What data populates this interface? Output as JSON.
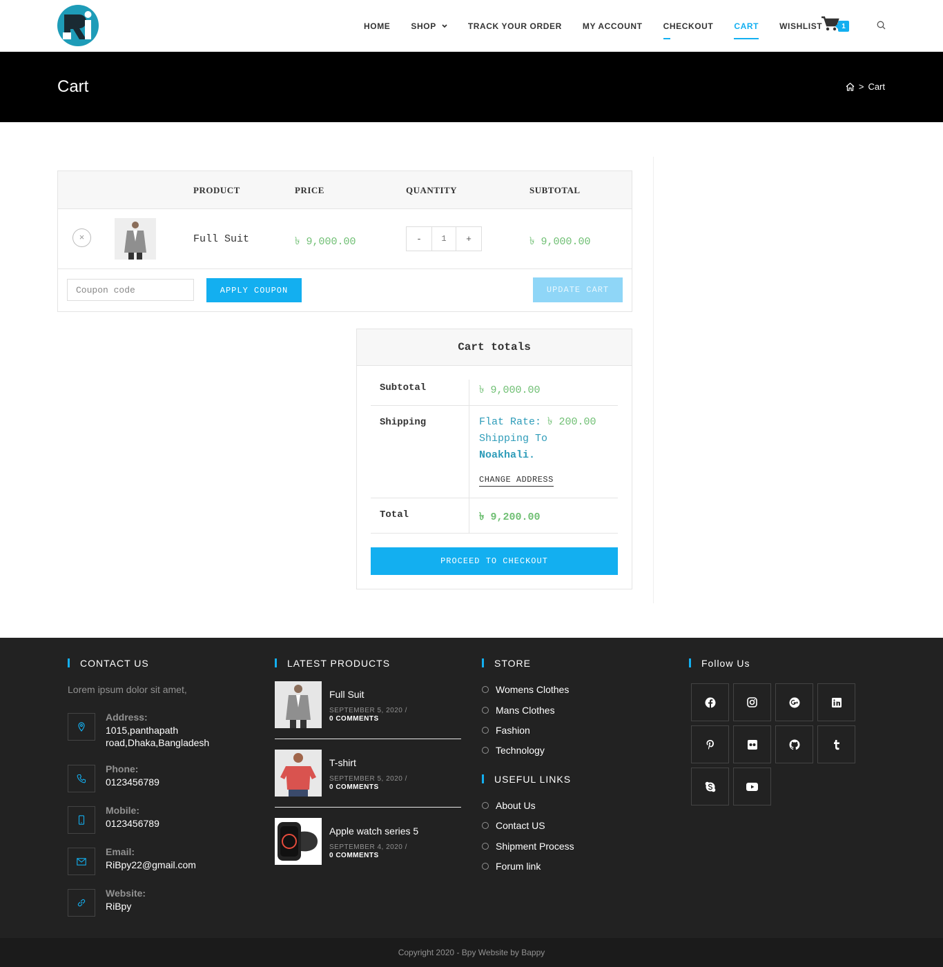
{
  "header": {
    "logo_text": "Ri",
    "nav": [
      {
        "label": "HOME"
      },
      {
        "label": "SHOP"
      },
      {
        "label": "TRACK YOUR ORDER"
      },
      {
        "label": "MY ACCOUNT"
      },
      {
        "label": "CHECKOUT"
      },
      {
        "label": "CART"
      },
      {
        "label": "WISHLIST"
      }
    ],
    "cart_count": "1",
    "accent_color": "#13aff0"
  },
  "titlebar": {
    "title": "Cart",
    "breadcrumb_current": "Cart",
    "breadcrumb_sep": ">"
  },
  "cart": {
    "columns": [
      "PRODUCT",
      "PRICE",
      "QUANTITY",
      "SUBTOTAL"
    ],
    "items": [
      {
        "name": "Full Suit",
        "price": "৳ 9,000.00",
        "quantity": "1",
        "subtotal": "৳ 9,000.00"
      }
    ],
    "qty_minus": "-",
    "qty_plus": "+",
    "remove_symbol": "×",
    "coupon_placeholder": "Coupon code",
    "apply_coupon_label": "APPLY COUPON",
    "update_cart_label": "UPDATE CART"
  },
  "totals": {
    "title": "Cart totals",
    "subtotal_label": "Subtotal",
    "subtotal_value": "৳ 9,000.00",
    "shipping_label": "Shipping",
    "shipping_rate_label": "Flat Rate:",
    "shipping_rate_value": "৳ 200.00",
    "shipping_to": "Shipping To",
    "shipping_location": "Noakhali.",
    "change_address_label": "CHANGE ADDRESS",
    "total_label": "Total",
    "total_value": "৳ 9,200.00",
    "checkout_label": "PROCEED TO CHECKOUT"
  },
  "footer": {
    "contact": {
      "heading": "CONTACT US",
      "intro": "Lorem ipsum dolor sit amet,",
      "items": [
        {
          "label": "Address:",
          "value": "1015,panthapath road,Dhaka,Bangladesh",
          "icon": "location-icon"
        },
        {
          "label": "Phone:",
          "value": "0123456789",
          "icon": "phone-icon"
        },
        {
          "label": "Mobile:",
          "value": "0123456789",
          "icon": "mobile-icon"
        },
        {
          "label": "Email:",
          "value": "RiBpy22@gmail.com",
          "icon": "email-icon"
        },
        {
          "label": "Website:",
          "value": "RiBpy",
          "icon": "link-icon"
        }
      ]
    },
    "latest": {
      "heading": "LATEST PRODUCTS",
      "items": [
        {
          "title": "Full Suit",
          "date": "SEPTEMBER 5, 2020 /",
          "comments": "0 COMMENTS"
        },
        {
          "title": "T-shirt",
          "date": "SEPTEMBER 5, 2020 /",
          "comments": "0 COMMENTS"
        },
        {
          "title": "Apple watch series 5",
          "date": "SEPTEMBER 4, 2020 /",
          "comments": "0 COMMENTS"
        }
      ]
    },
    "store": {
      "heading": "STORE",
      "items": [
        "Womens Clothes",
        "Mans Clothes",
        "Fashion",
        "Technology"
      ]
    },
    "useful": {
      "heading": "USEFUL LINKS",
      "items": [
        "About Us",
        "Contact US",
        "Shipment Process",
        "Forum link"
      ]
    },
    "follow": {
      "heading": "Follow Us",
      "icons": [
        "facebook-icon",
        "instagram-icon",
        "google-plus-icon",
        "linkedin-icon",
        "pinterest-icon",
        "flickr-icon",
        "github-icon",
        "tumblr-icon",
        "skype-icon",
        "youtube-icon"
      ]
    },
    "copyright": "Copyright 2020 - Bpy Website by Bappy"
  }
}
